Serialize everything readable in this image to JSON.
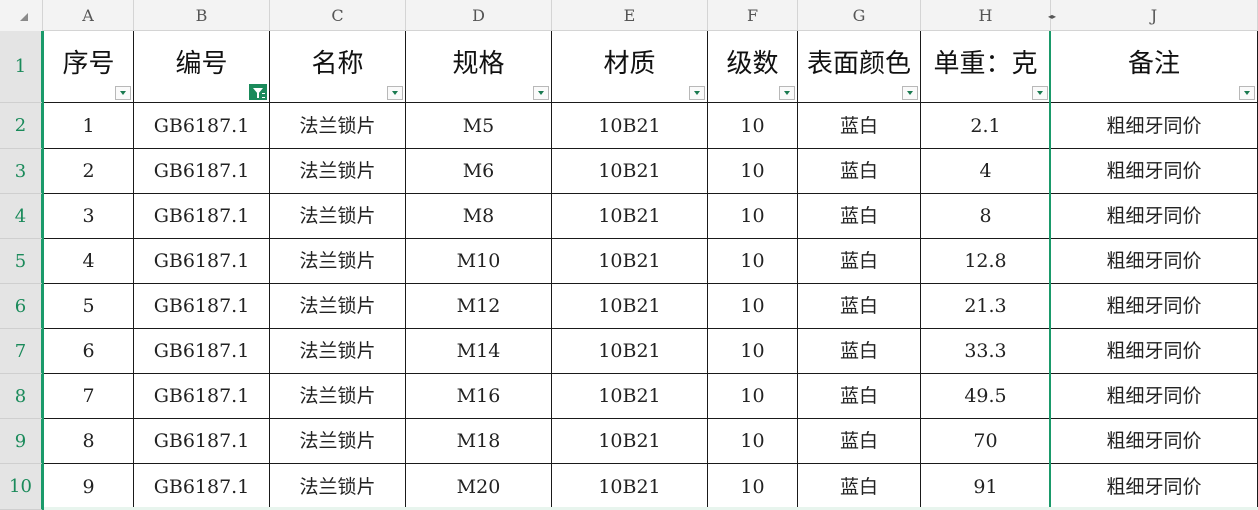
{
  "column_letters": [
    "A",
    "B",
    "C",
    "D",
    "E",
    "F",
    "G",
    "H",
    "J"
  ],
  "row_numbers": [
    "1",
    "2",
    "3",
    "4",
    "5",
    "6",
    "7",
    "8",
    "9",
    "10"
  ],
  "header_row": [
    "序号",
    "编号",
    "名称",
    "规格",
    "材质",
    "级数",
    "表面颜色",
    "单重：克",
    "备注"
  ],
  "filter_active_column": "B",
  "data_rows": [
    [
      "1",
      "GB6187.1",
      "法兰锁片",
      "M5",
      "10B21",
      "10",
      "蓝白",
      "2.1",
      "粗细牙同价"
    ],
    [
      "2",
      "GB6187.1",
      "法兰锁片",
      "M6",
      "10B21",
      "10",
      "蓝白",
      "4",
      "粗细牙同价"
    ],
    [
      "3",
      "GB6187.1",
      "法兰锁片",
      "M8",
      "10B21",
      "10",
      "蓝白",
      "8",
      "粗细牙同价"
    ],
    [
      "4",
      "GB6187.1",
      "法兰锁片",
      "M10",
      "10B21",
      "10",
      "蓝白",
      "12.8",
      "粗细牙同价"
    ],
    [
      "5",
      "GB6187.1",
      "法兰锁片",
      "M12",
      "10B21",
      "10",
      "蓝白",
      "21.3",
      "粗细牙同价"
    ],
    [
      "6",
      "GB6187.1",
      "法兰锁片",
      "M14",
      "10B21",
      "10",
      "蓝白",
      "33.3",
      "粗细牙同价"
    ],
    [
      "7",
      "GB6187.1",
      "法兰锁片",
      "M16",
      "10B21",
      "10",
      "蓝白",
      "49.5",
      "粗细牙同价"
    ],
    [
      "8",
      "GB6187.1",
      "法兰锁片",
      "M18",
      "10B21",
      "10",
      "蓝白",
      "70",
      "粗细牙同价"
    ],
    [
      "9",
      "GB6187.1",
      "法兰锁片",
      "M20",
      "10B21",
      "10",
      "蓝白",
      "91",
      "粗细牙同价"
    ]
  ],
  "colors": {
    "accent": "#1a8a5a",
    "gridline": "#1a1a1a",
    "header_bg": "#f3f3f3"
  }
}
